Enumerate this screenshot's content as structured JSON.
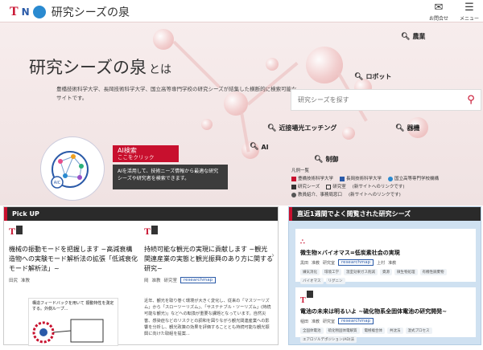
{
  "header": {
    "logo_t": "T",
    "logo_n": "N",
    "site_title": "研究シーズの泉",
    "contact_label": "お問合せ",
    "menu_label": "メニュー",
    "contact_icon": "mail-icon",
    "menu_icon": "hamburger-icon"
  },
  "hero": {
    "title": "研究シーズの泉",
    "title_suffix": "とは",
    "description": "豊橋技術科学大学、長岡技術科学大学、国立高等専門学校の研究シーズが結集した横断的に検索可能なサイトです。",
    "search_placeholder": "研究シーズを探す",
    "tags": [
      "農業",
      "ロボット",
      "近接場光エッチング",
      "器機",
      "AI",
      "制御"
    ]
  },
  "ai": {
    "button_title": "AI検索",
    "button_sub": "ここをクリック",
    "circle_label": "AIC",
    "description": "AIを活用して、技術ニーズ情報から最適な研究シーズや研究者を検索できます。"
  },
  "legend": {
    "heading": "凡例一覧",
    "row1": [
      "豊橋技術科学大学",
      "長岡技術科学大学",
      "国立高等専門学校機構"
    ],
    "row2": [
      "研究シーズ",
      "研究室",
      "(新サイトへのリンクです)"
    ],
    "row3": [
      "教員紹介、事務局窓口",
      "(新サイトへのリンクです)"
    ]
  },
  "pickup": {
    "heading": "Pick UP",
    "cards": [
      {
        "title": "機械の振動モードを把握します ~高減衰構造物への実験モード解析法の拡張「低減衰化モード解析法」~",
        "meta_author": "田尻",
        "meta_role": "准教",
        "meta_lab": "研究室",
        "meta_rm": "researchmap",
        "fig_text": "構造フィードバックを用いて 振動特性を測定する。外側ループ..."
      },
      {
        "title": "持続可能な観光の実現に貢献します ~観光関連産業の実態と観光振興のあり方に関する研究~",
        "meta_author": "岡",
        "meta_role": "准教",
        "meta_lab": "研究室",
        "meta_rm": "researchmap",
        "body": "近年、観光を取り巻く環境が大きく変化し、従来の「マスツーリズム」から「スローツーリズム」、「サステナブル・ツーリズム」(持続可能な観光)」などへの転換が重要な課題となっています。自然災害、感染症などのリスクとの調和を図りながら観光関連産業への影響を分析し、観光政策の効果を評価することとも持続可能な観光振興に向けた取組を提案..."
      }
    ]
  },
  "recent": {
    "heading": "直近1週間でよく閲覧された研究シーズ",
    "cards": [
      {
        "title": "微生物×バイオマス=低炭素社会の実現",
        "meta_author": "黒田",
        "meta_role": "准教",
        "meta_lab": "研究室",
        "meta_rm": "researchmap",
        "meta_author2": "上村",
        "meta_role2": "准教",
        "chips": [
          "嫌気消化",
          "環境工学",
          "温室効果ガス削減",
          "資源",
          "微生物処理",
          "有機性廃棄物",
          "バイオマス",
          "リグニン"
        ]
      },
      {
        "title": "電池の未来は明るいよ ~硫化物系全固体電池の研究開発~",
        "meta_author": "稲田",
        "meta_role": "准教",
        "meta_lab": "研究室",
        "meta_rm": "researchmap",
        "chips": [
          "全固体電池",
          "硫化物固体電解質",
          "電極複合体",
          "共沈法",
          "湿式プロセス",
          "エアロゾルデポジション(AD)法"
        ]
      }
    ]
  }
}
